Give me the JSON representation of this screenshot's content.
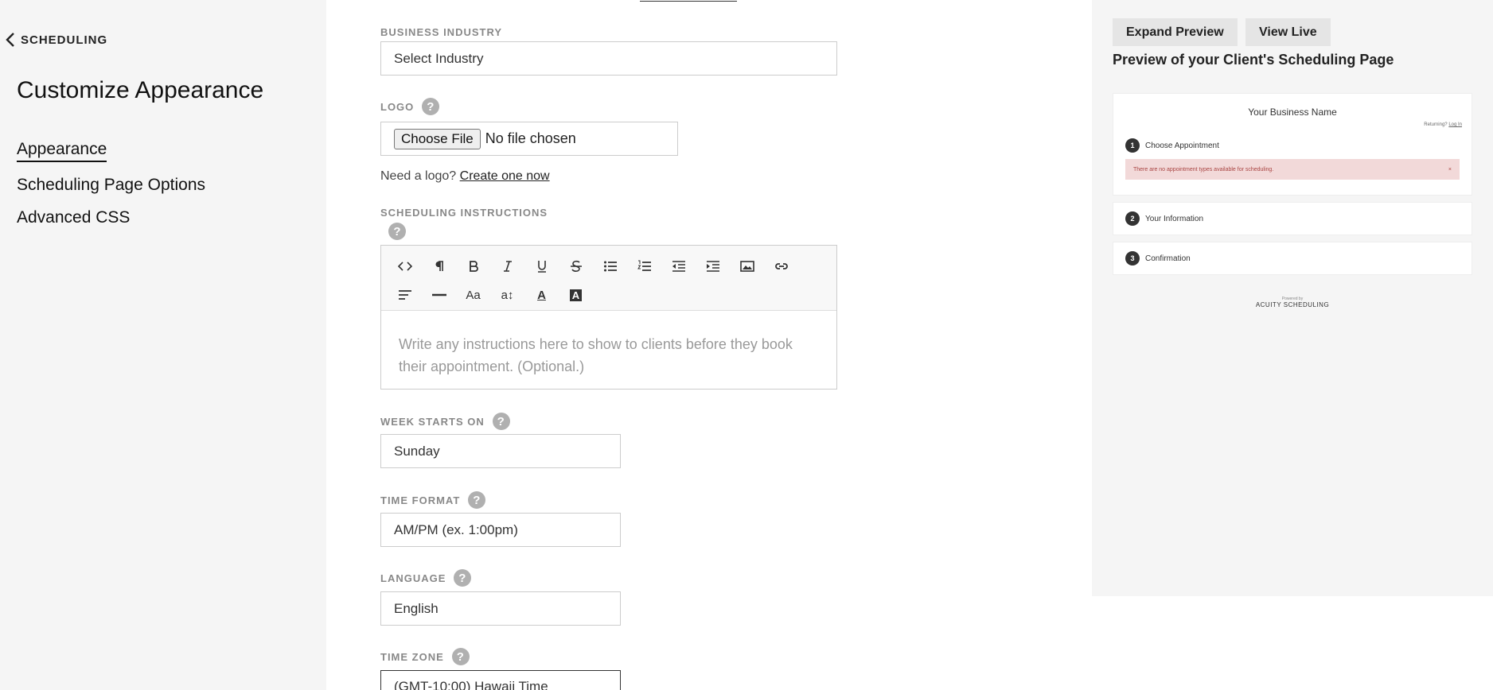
{
  "sidebar": {
    "back_label": "SCHEDULING",
    "title": "Customize Appearance",
    "items": [
      {
        "label": "Appearance",
        "active": true
      },
      {
        "label": "Scheduling Page Options",
        "active": false
      },
      {
        "label": "Advanced CSS",
        "active": false
      }
    ]
  },
  "form": {
    "industry": {
      "label": "BUSINESS INDUSTRY",
      "value": "Select Industry"
    },
    "logo": {
      "label": "LOGO",
      "button": "Choose File",
      "status": "No file chosen",
      "hint_text": "Need a logo?",
      "hint_link": "Create one now"
    },
    "instructions": {
      "label": "SCHEDULING INSTRUCTIONS",
      "placeholder": "Write any instructions here to show to clients before they book their appointment. (Optional.)"
    },
    "week_start": {
      "label": "WEEK STARTS ON",
      "value": "Sunday"
    },
    "time_format": {
      "label": "TIME FORMAT",
      "value": "AM/PM (ex. 1:00pm)"
    },
    "language": {
      "label": "LANGUAGE",
      "value": "English"
    },
    "time_zone": {
      "label": "TIME ZONE",
      "value": "(GMT-10:00) Hawaii Time"
    },
    "help_glyph": "?"
  },
  "toolbar": {
    "row2": [
      "Aa",
      "a↕",
      "A",
      "A"
    ]
  },
  "preview": {
    "expand_label": "Expand Preview",
    "view_live_label": "View Live",
    "title": "Preview of your Client's Scheduling Page",
    "business_name": "Your Business Name",
    "returning_text": "Returning?",
    "login_text": "Log In",
    "steps": [
      {
        "num": "1",
        "label": "Choose Appointment"
      },
      {
        "num": "2",
        "label": "Your Information"
      },
      {
        "num": "3",
        "label": "Confirmation"
      }
    ],
    "alert": "There are no appointment types available for scheduling.",
    "alert_close": "×",
    "powered_by": "Powered by",
    "brand": "ACUITY SCHEDULING"
  },
  "colors": {
    "sidebar_bg": "#f5f5f5",
    "preview_bg": "#f5f5f5",
    "alert_bg": "#f2d9d9",
    "alert_text": "#a94442"
  }
}
